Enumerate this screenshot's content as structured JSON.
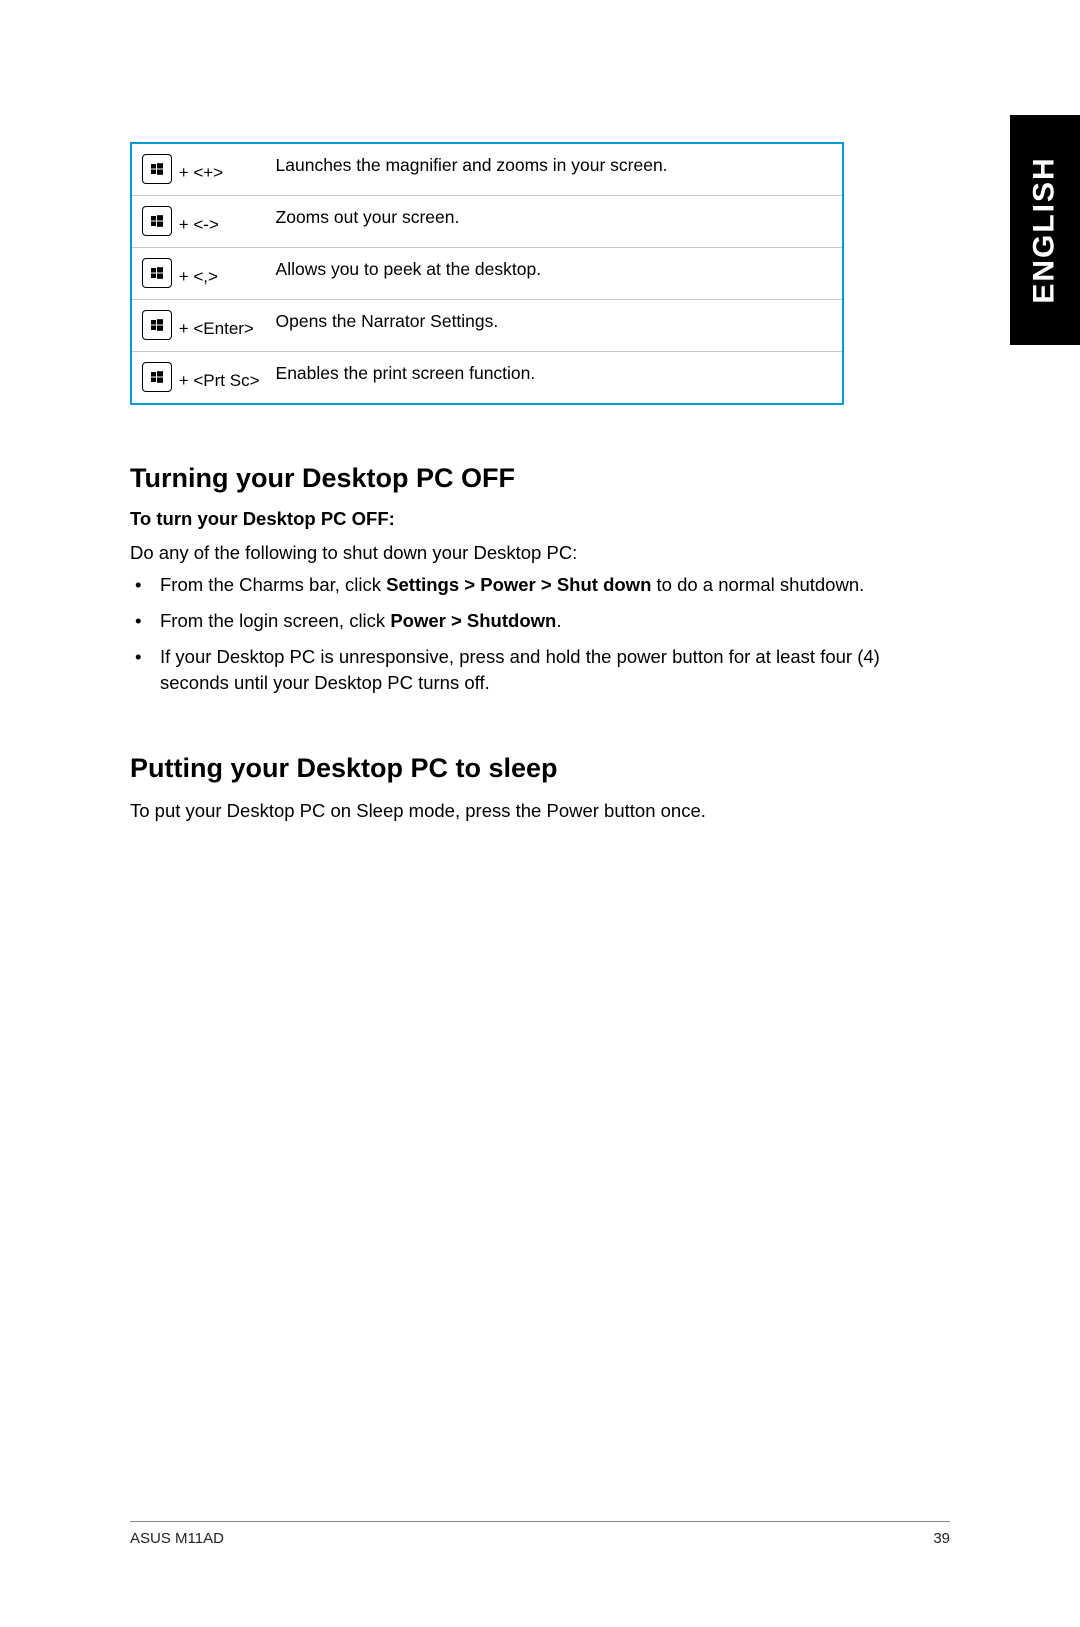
{
  "language_tab": "ENGLISH",
  "shortcuts": [
    {
      "combo": " + <+>",
      "desc": "Launches the magnifier and zooms in your screen."
    },
    {
      "combo": " + <->",
      "desc": "Zooms out your screen."
    },
    {
      "combo": " + <,>",
      "desc": "Allows you to peek at the desktop."
    },
    {
      "combo": " + <Enter>",
      "desc": "Opens the Narrator Settings."
    },
    {
      "combo": " + <Prt Sc>",
      "desc": "Enables the print screen function."
    }
  ],
  "section1": {
    "heading": "Turning your Desktop PC OFF",
    "subheading": "To turn your Desktop PC OFF:",
    "intro": "Do any of the following to shut down your Desktop PC:",
    "bullets_html": [
      "From the Charms bar, click <b>Settings > Power > Shut down</b> to do a normal shutdown.",
      "From the login screen, click <b>Power > Shutdown</b>.",
      "If your Desktop PC is unresponsive, press and hold the power  button for at least four (4) seconds until your Desktop PC turns off."
    ]
  },
  "section2": {
    "heading": "Putting your Desktop PC to sleep",
    "body": "To put your Desktop PC on Sleep mode, press the Power button once."
  },
  "footer": {
    "model": "ASUS M11AD",
    "page": "39"
  }
}
